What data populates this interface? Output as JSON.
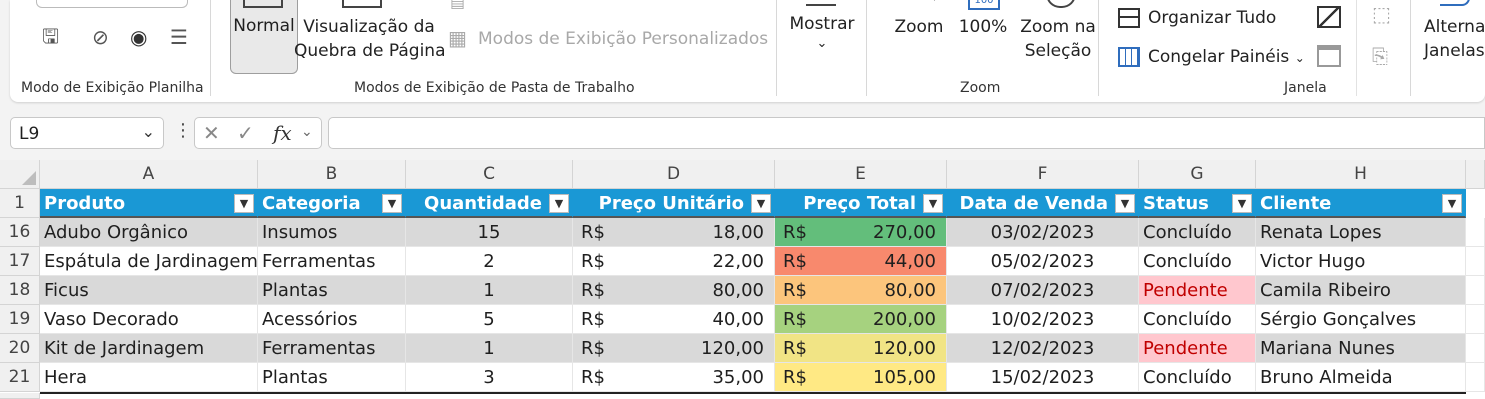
{
  "ribbon": {
    "groups": {
      "sheet_view": "Modo de Exibição Planilha",
      "workbook_views": "Modos de Exibição de Pasta de Trabalho",
      "zoom": "Zoom",
      "window": "Janela"
    },
    "normal": "Normal",
    "page_break_1": "Visualização da",
    "page_break_2": "Quebra de Página",
    "custom_views": "Modos de Exibição Personalizados",
    "show": "Mostrar",
    "zoom": "Zoom",
    "zoom100": "100%",
    "zoom_sel_1": "Zoom na",
    "zoom_sel_2": "Seleção",
    "arrange_all": "Organizar Tudo",
    "freeze_panes": "Congelar Painéis",
    "switch_1": "Alterna",
    "switch_2": "Janelas"
  },
  "formula_bar": {
    "name_box": "L9",
    "fx": "fx",
    "formula": ""
  },
  "columns": [
    "A",
    "B",
    "C",
    "D",
    "E",
    "F",
    "G",
    "H"
  ],
  "headers": [
    "Produto",
    "Categoria",
    "Quantidade",
    "Preço Unitário",
    "Preço Total",
    "Data de Venda",
    "Status",
    "Cliente"
  ],
  "rows": [
    {
      "num": "16",
      "produto": "Adubo Orgânico",
      "categoria": "Insumos",
      "qtd": "15",
      "cur_u": "R$",
      "unit": "18,00",
      "cur_t": "R$",
      "total": "270,00",
      "data": "03/02/2023",
      "status": "Concluído",
      "cliente": "Renata Lopes"
    },
    {
      "num": "17",
      "produto": "Espátula de Jardinagem",
      "categoria": "Ferramentas",
      "qtd": "2",
      "cur_u": "R$",
      "unit": "22,00",
      "cur_t": "R$",
      "total": "44,00",
      "data": "05/02/2023",
      "status": "Concluído",
      "cliente": "Victor Hugo"
    },
    {
      "num": "18",
      "produto": "Ficus",
      "categoria": "Plantas",
      "qtd": "1",
      "cur_u": "R$",
      "unit": "80,00",
      "cur_t": "R$",
      "total": "80,00",
      "data": "07/02/2023",
      "status": "Pendente",
      "cliente": "Camila Ribeiro"
    },
    {
      "num": "19",
      "produto": "Vaso Decorado",
      "categoria": "Acessórios",
      "qtd": "5",
      "cur_u": "R$",
      "unit": "40,00",
      "cur_t": "R$",
      "total": "200,00",
      "data": "10/02/2023",
      "status": "Concluído",
      "cliente": "Sérgio Gonçalves"
    },
    {
      "num": "20",
      "produto": "Kit de Jardinagem",
      "categoria": "Ferramentas",
      "qtd": "1",
      "cur_u": "R$",
      "unit": "120,00",
      "cur_t": "R$",
      "total": "120,00",
      "data": "12/02/2023",
      "status": "Pendente",
      "cliente": "Mariana Nunes"
    },
    {
      "num": "21",
      "produto": "Hera",
      "categoria": "Plantas",
      "qtd": "3",
      "cur_u": "R$",
      "unit": "35,00",
      "cur_t": "R$",
      "total": "105,00",
      "data": "15/02/2023",
      "status": "Concluído",
      "cliente": "Bruno Almeida"
    }
  ],
  "header_row_num": "1",
  "colors": {
    "header_bg": "#1a98d5",
    "total_270": "#63be7b",
    "total_44": "#f8896d",
    "total_80": "#fcc57c",
    "total_200": "#a6d27f",
    "total_120": "#f1e485",
    "total_105": "#ffe984",
    "pending_bg": "#ffc7ce",
    "pending_fg": "#c00000"
  }
}
